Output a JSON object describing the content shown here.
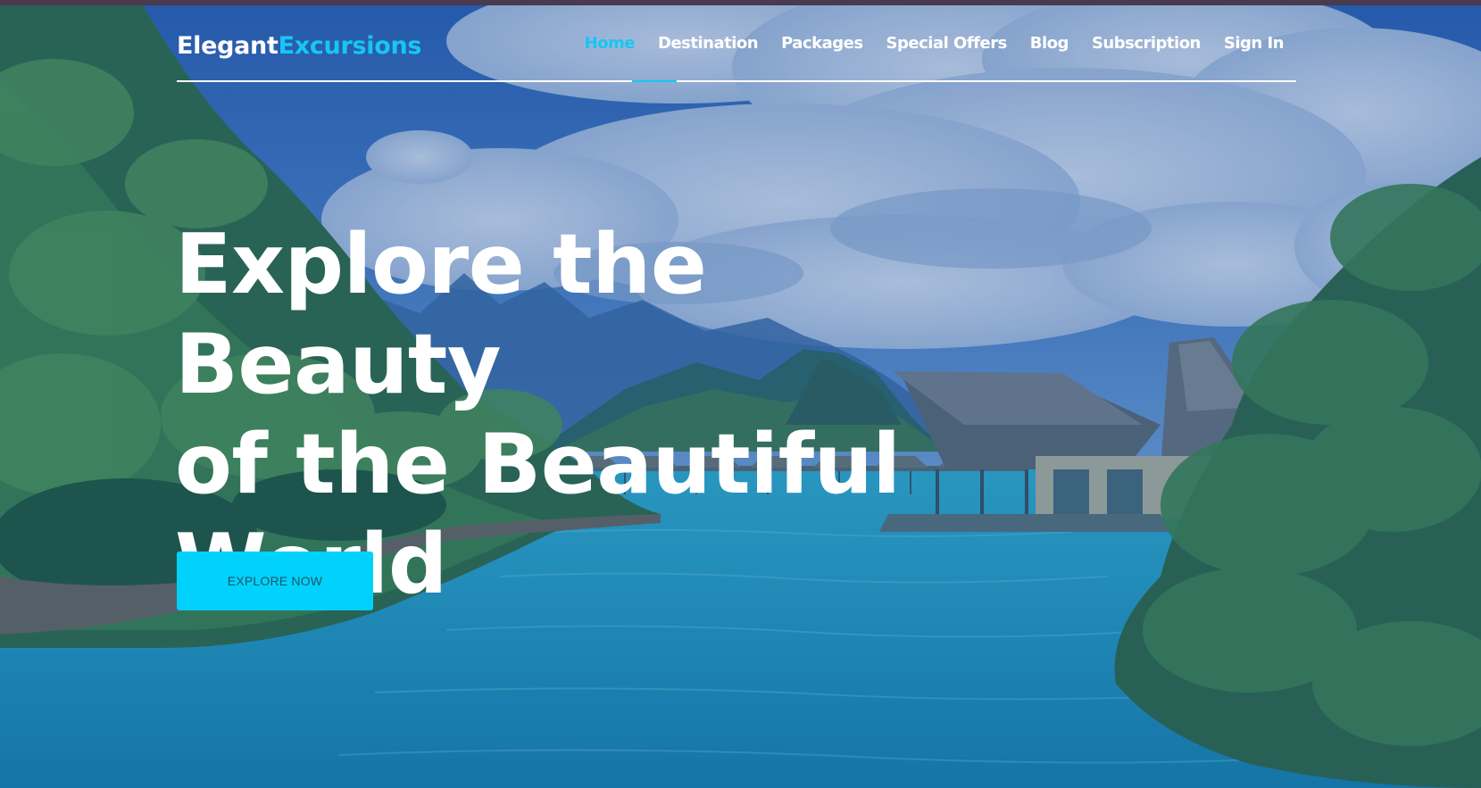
{
  "brand": {
    "part1": "Elegant",
    "part2": "Excursions"
  },
  "nav": {
    "items": [
      {
        "label": "Home",
        "active": true
      },
      {
        "label": "Destination",
        "active": false
      },
      {
        "label": "Packages",
        "active": false
      },
      {
        "label": "Special Offers",
        "active": false
      },
      {
        "label": "Blog",
        "active": false
      },
      {
        "label": "Subscription",
        "active": false
      },
      {
        "label": "Sign In",
        "active": false
      }
    ]
  },
  "hero": {
    "title_lines": [
      "Explore the Beauty",
      "of the Beautiful",
      "World"
    ],
    "cta_label": "EXPLORE NOW"
  },
  "colors": {
    "accent": "#17c6f2",
    "button": "#00d2fd",
    "top_strip": "#4a3a4f",
    "text": "#ffffff"
  }
}
